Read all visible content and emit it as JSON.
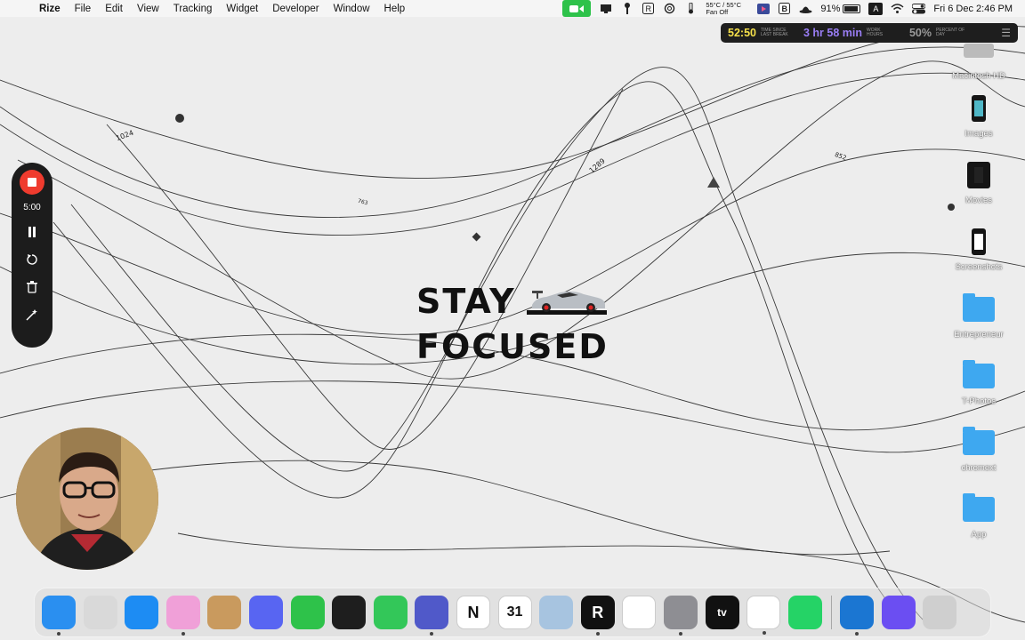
{
  "menubar": {
    "apple_glyph": "",
    "app_name": "Rize",
    "menus": [
      "File",
      "Edit",
      "View",
      "Tracking",
      "Widget",
      "Developer",
      "Window",
      "Help"
    ],
    "temperature_line1": "55°C / 55°C",
    "temperature_line2": "Fan Off",
    "battery_percent": "91%",
    "input_source": "A",
    "datetime": "Fri 6 Dec  2:46 PM"
  },
  "rize": {
    "timer_value": "52:50",
    "timer_caption": "TIME SINCE LAST BREAK",
    "work_value": "3 hr 58 min",
    "work_caption": "WORK HOURS",
    "percent_value": "50%",
    "percent_caption": "PERCENT OF DAY",
    "colors": {
      "timer": "#f5e04a",
      "work": "#9a7ef5",
      "percent": "#9a9a9a"
    }
  },
  "timer_widget": {
    "time": "5:00",
    "stop_color": "#ef3b2e"
  },
  "wallpaper": {
    "title_line1": "STAY",
    "title_line2": "FOCUSED",
    "annotations": [
      "1024",
      "763",
      "1289",
      "852"
    ]
  },
  "desktop": {
    "items": [
      {
        "label": "Macintosh HD",
        "icon": "disk-icon"
      },
      {
        "label": "Images",
        "icon": "phone-icon"
      },
      {
        "label": "Movies",
        "icon": "phone-icon"
      },
      {
        "label": "Screenshots",
        "icon": "phone-icon"
      },
      {
        "label": "Entrepreneur",
        "icon": "folder-icon"
      },
      {
        "label": "T-Photos",
        "icon": "folder-icon"
      },
      {
        "label": "chromext",
        "icon": "folder-icon"
      },
      {
        "label": "App",
        "icon": "folder-icon"
      }
    ]
  },
  "dock": {
    "apps": [
      {
        "name": "finder-icon",
        "color": "#2a8ff0",
        "glyph": ""
      },
      {
        "name": "launchpad-icon",
        "color": "#d9d9d9",
        "glyph": ""
      },
      {
        "name": "app-store-icon",
        "color": "#1d8cf3",
        "glyph": ""
      },
      {
        "name": "craft-icon",
        "color": "#f0a0d8",
        "glyph": ""
      },
      {
        "name": "contacts-icon",
        "color": "#c99a5e",
        "glyph": ""
      },
      {
        "name": "discord-icon",
        "color": "#5865f2",
        "glyph": ""
      },
      {
        "name": "facetime-icon",
        "color": "#2ec24a",
        "glyph": ""
      },
      {
        "name": "figma-icon",
        "color": "#1e1e1e",
        "glyph": ""
      },
      {
        "name": "messages-icon",
        "color": "#33c759",
        "glyph": ""
      },
      {
        "name": "teams-icon",
        "color": "#5059c9",
        "glyph": ""
      },
      {
        "name": "notion-icon",
        "color": "#ffffff",
        "glyph": "N"
      },
      {
        "name": "calendar-icon",
        "color": "#ffffff",
        "glyph": "31"
      },
      {
        "name": "preview-icon",
        "color": "#a7c4e0",
        "glyph": ""
      },
      {
        "name": "rize-icon",
        "color": "#111111",
        "glyph": "R"
      },
      {
        "name": "slack-icon",
        "color": "#ffffff",
        "glyph": ""
      },
      {
        "name": "system-settings-icon",
        "color": "#8e8e93",
        "glyph": ""
      },
      {
        "name": "apple-tv-icon",
        "color": "#111111",
        "glyph": "tv"
      },
      {
        "name": "vscode-icon",
        "color": "#ffffff",
        "glyph": ""
      },
      {
        "name": "whatsapp-icon",
        "color": "#25d366",
        "glyph": ""
      }
    ],
    "pinned_right": [
      {
        "name": "xcode-icon",
        "color": "#1b76d2",
        "glyph": ""
      },
      {
        "name": "perplexity-icon",
        "color": "#6b4ef2",
        "glyph": ""
      },
      {
        "name": "trash-icon",
        "color": "#cfcfcf",
        "glyph": ""
      }
    ]
  }
}
